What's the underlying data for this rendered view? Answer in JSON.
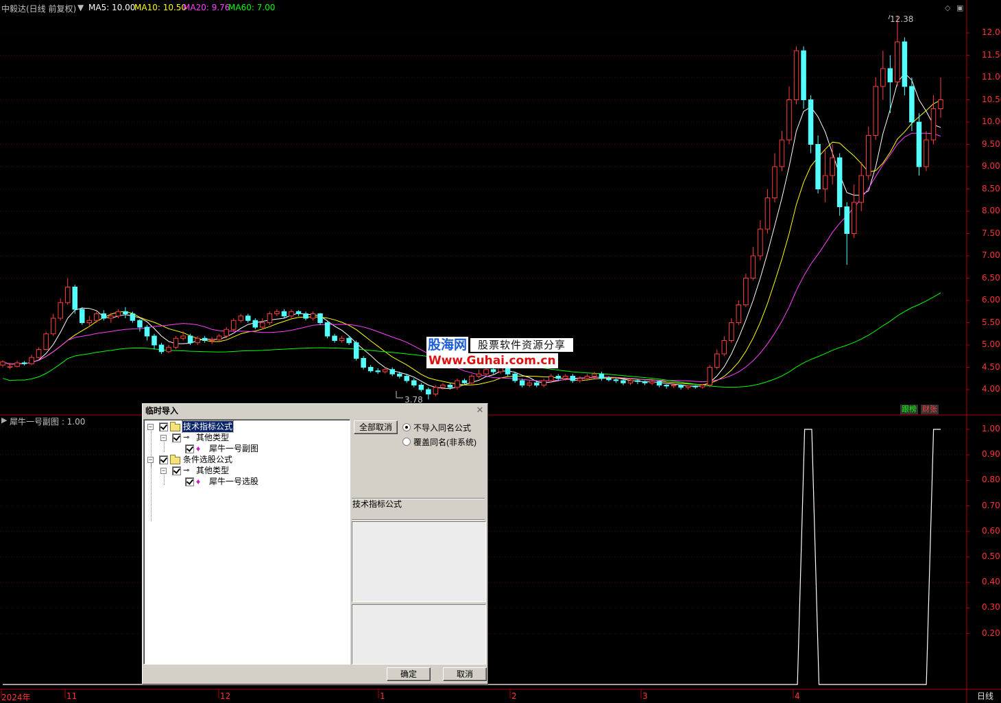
{
  "header": {
    "stock_title": "中毅达(日线 前复权)",
    "indicators": [
      {
        "label": "MA5: 10.00",
        "color": "#ffffff"
      },
      {
        "label": "MA10: 10.50",
        "color": "#ffff00"
      },
      {
        "label": "MA20: 9.76",
        "color": "#ff40ff"
      },
      {
        "label": "MA60: 7.00",
        "color": "#00ff00"
      }
    ]
  },
  "sub_header": {
    "label": "犀牛一号副图 : 1.00"
  },
  "price_axis": [
    "12.00",
    "11.50",
    "11.00",
    "10.50",
    "10.00",
    "9.50",
    "9.00",
    "8.50",
    "8.00",
    "7.50",
    "7.00",
    "6.50",
    "6.00",
    "5.50",
    "5.00",
    "4.50",
    "4.00"
  ],
  "sub_axis": [
    "1.00",
    "0.90",
    "0.80",
    "0.70",
    "0.60",
    "0.50",
    "0.40",
    "0.30",
    "0.20"
  ],
  "time_axis": [
    "2024年",
    "11",
    "12",
    "1",
    "2",
    "3",
    "4"
  ],
  "period": "日线",
  "tags": {
    "left": "跟榜",
    "right": "财张"
  },
  "annotations": {
    "high": "12.38",
    "low": "3.78"
  },
  "watermark": {
    "logo": "股海网",
    "slogan": "股票软件资源分享",
    "url": "Www.Guhai.com.cn"
  },
  "dialog": {
    "title": "临时导入",
    "tree": [
      {
        "label": "技术指标公式",
        "level": 0,
        "type": "folder",
        "selected": true
      },
      {
        "label": "其他类型",
        "level": 1,
        "type": "type"
      },
      {
        "label": "犀牛一号副图",
        "level": 2,
        "type": "formula"
      },
      {
        "label": "条件选股公式",
        "level": 0,
        "type": "folder"
      },
      {
        "label": "其他类型",
        "level": 1,
        "type": "type"
      },
      {
        "label": "犀牛一号选股",
        "level": 2,
        "type": "formula"
      }
    ],
    "cancel_all": "全部取消",
    "options": [
      {
        "label": "不导入同名公式",
        "checked": true
      },
      {
        "label": "覆盖同名(非系统)",
        "checked": false
      }
    ],
    "info_label": "技术指标公式",
    "ok": "确定",
    "cancel": "取消"
  },
  "chart_data": [
    {
      "type": "candlestick",
      "title": "中毅达(日线 前复权)",
      "ylim": [
        3.6,
        12.4
      ],
      "x_ticks": [
        "2024年",
        "11",
        "12",
        "1",
        "2",
        "3",
        "4"
      ],
      "annotations": [
        {
          "label": "12.38",
          "kind": "high"
        },
        {
          "label": "3.78",
          "kind": "low"
        }
      ],
      "candles": [
        [
          4.55,
          4.62,
          4.5,
          4.66
        ],
        [
          4.5,
          4.52,
          4.46,
          4.6
        ],
        [
          4.52,
          4.6,
          4.5,
          4.65
        ],
        [
          4.6,
          4.58,
          4.54,
          4.64
        ],
        [
          4.58,
          4.72,
          4.55,
          4.78
        ],
        [
          4.72,
          4.9,
          4.7,
          4.95
        ],
        [
          4.9,
          5.25,
          4.88,
          5.3
        ],
        [
          5.25,
          5.6,
          5.2,
          5.7
        ],
        [
          5.6,
          5.95,
          5.55,
          6.05
        ],
        [
          5.95,
          6.3,
          5.9,
          6.5
        ],
        [
          6.3,
          5.8,
          5.7,
          6.35
        ],
        [
          5.8,
          5.5,
          5.45,
          5.85
        ],
        [
          5.5,
          5.55,
          5.4,
          5.65
        ],
        [
          5.55,
          5.7,
          5.5,
          5.75
        ],
        [
          5.7,
          5.6,
          5.55,
          5.78
        ],
        [
          5.6,
          5.65,
          5.5,
          5.72
        ],
        [
          5.65,
          5.75,
          5.6,
          5.8
        ],
        [
          5.75,
          5.7,
          5.6,
          5.85
        ],
        [
          5.7,
          5.55,
          5.5,
          5.75
        ],
        [
          5.55,
          5.4,
          5.3,
          5.58
        ],
        [
          5.4,
          5.2,
          5.1,
          5.45
        ],
        [
          5.2,
          5.0,
          4.9,
          5.25
        ],
        [
          5.0,
          4.85,
          4.8,
          5.05
        ],
        [
          4.85,
          4.95,
          4.82,
          5.0
        ],
        [
          4.95,
          5.15,
          4.9,
          5.2
        ],
        [
          5.15,
          5.2,
          5.1,
          5.3
        ],
        [
          5.2,
          5.05,
          5.0,
          5.25
        ],
        [
          5.05,
          5.15,
          5.0,
          5.2
        ],
        [
          5.15,
          5.1,
          5.05,
          5.2
        ],
        [
          5.1,
          5.12,
          5.02,
          5.18
        ],
        [
          5.12,
          5.2,
          5.08,
          5.25
        ],
        [
          5.2,
          5.35,
          5.15,
          5.4
        ],
        [
          5.35,
          5.55,
          5.3,
          5.6
        ],
        [
          5.55,
          5.65,
          5.5,
          5.7
        ],
        [
          5.65,
          5.55,
          5.5,
          5.7
        ],
        [
          5.55,
          5.4,
          5.35,
          5.6
        ],
        [
          5.4,
          5.5,
          5.35,
          5.6
        ],
        [
          5.5,
          5.7,
          5.45,
          5.75
        ],
        [
          5.7,
          5.75,
          5.65,
          5.8
        ],
        [
          5.75,
          5.65,
          5.6,
          5.8
        ],
        [
          5.65,
          5.75,
          5.6,
          5.8
        ],
        [
          5.75,
          5.7,
          5.65,
          5.78
        ],
        [
          5.7,
          5.6,
          5.55,
          5.75
        ],
        [
          5.6,
          5.7,
          5.55,
          5.75
        ],
        [
          5.7,
          5.5,
          5.45,
          5.72
        ],
        [
          5.5,
          5.2,
          5.15,
          5.55
        ],
        [
          5.2,
          5.1,
          5.05,
          5.25
        ],
        [
          5.1,
          5.15,
          5.05,
          5.2
        ],
        [
          5.15,
          5.05,
          5.0,
          5.2
        ],
        [
          5.05,
          4.7,
          4.65,
          5.1
        ],
        [
          4.7,
          4.5,
          4.45,
          4.75
        ],
        [
          4.5,
          4.42,
          4.38,
          4.55
        ],
        [
          4.42,
          4.4,
          4.35,
          4.48
        ],
        [
          4.4,
          4.45,
          4.36,
          4.5
        ],
        [
          4.45,
          4.35,
          4.3,
          4.5
        ],
        [
          4.35,
          4.3,
          4.25,
          4.4
        ],
        [
          4.3,
          4.2,
          4.15,
          4.35
        ],
        [
          4.2,
          4.1,
          4.05,
          4.25
        ],
        [
          4.1,
          4.0,
          3.95,
          4.15
        ],
        [
          4.0,
          3.9,
          3.78,
          4.05
        ],
        [
          3.9,
          4.05,
          3.85,
          4.1
        ],
        [
          4.05,
          4.1,
          4.0,
          4.15
        ],
        [
          4.1,
          4.05,
          4.0,
          4.15
        ],
        [
          4.05,
          4.2,
          4.0,
          4.25
        ],
        [
          4.2,
          4.15,
          4.1,
          4.25
        ],
        [
          4.15,
          4.3,
          4.1,
          4.35
        ],
        [
          4.3,
          4.35,
          4.25,
          4.45
        ],
        [
          4.35,
          4.45,
          4.3,
          4.5
        ],
        [
          4.45,
          4.4,
          4.35,
          4.5
        ],
        [
          4.4,
          4.55,
          4.35,
          4.6
        ],
        [
          4.55,
          4.35,
          4.3,
          4.58
        ],
        [
          4.35,
          4.2,
          4.15,
          4.4
        ],
        [
          4.2,
          4.1,
          4.05,
          4.25
        ],
        [
          4.1,
          4.15,
          4.05,
          4.2
        ],
        [
          4.15,
          4.1,
          4.05,
          4.2
        ],
        [
          4.1,
          4.2,
          4.05,
          4.25
        ],
        [
          4.2,
          4.3,
          4.15,
          4.35
        ],
        [
          4.3,
          4.25,
          4.2,
          4.35
        ],
        [
          4.25,
          4.3,
          4.2,
          4.35
        ],
        [
          4.3,
          4.2,
          4.15,
          4.35
        ],
        [
          4.2,
          4.25,
          4.15,
          4.3
        ],
        [
          4.25,
          4.3,
          4.2,
          4.35
        ],
        [
          4.3,
          4.35,
          4.25,
          4.4
        ],
        [
          4.35,
          4.25,
          4.2,
          4.4
        ],
        [
          4.25,
          4.22,
          4.18,
          4.3
        ],
        [
          4.22,
          4.2,
          4.15,
          4.25
        ],
        [
          4.2,
          4.15,
          4.1,
          4.25
        ],
        [
          4.15,
          4.2,
          4.1,
          4.25
        ],
        [
          4.2,
          4.18,
          4.12,
          4.22
        ],
        [
          4.18,
          4.15,
          4.1,
          4.2
        ],
        [
          4.15,
          4.18,
          4.1,
          4.22
        ],
        [
          4.18,
          4.1,
          4.05,
          4.2
        ],
        [
          4.1,
          4.08,
          4.02,
          4.12
        ],
        [
          4.08,
          4.1,
          4.03,
          4.14
        ],
        [
          4.1,
          4.05,
          4.0,
          4.12
        ],
        [
          4.05,
          4.08,
          4.0,
          4.1
        ],
        [
          4.08,
          4.06,
          4.02,
          4.1
        ],
        [
          4.06,
          4.1,
          4.02,
          4.12
        ],
        [
          4.1,
          4.5,
          4.05,
          4.55
        ],
        [
          4.5,
          4.8,
          4.45,
          4.9
        ],
        [
          4.8,
          5.1,
          4.75,
          5.2
        ],
        [
          5.1,
          5.5,
          5.05,
          5.6
        ],
        [
          5.5,
          5.9,
          5.45,
          6.0
        ],
        [
          5.9,
          6.5,
          5.85,
          6.6
        ],
        [
          6.5,
          7.0,
          6.45,
          7.2
        ],
        [
          7.0,
          7.6,
          6.9,
          7.8
        ],
        [
          7.6,
          8.3,
          7.5,
          8.5
        ],
        [
          8.3,
          9.0,
          8.2,
          9.3
        ],
        [
          9.0,
          9.6,
          8.9,
          9.8
        ],
        [
          9.6,
          10.5,
          9.5,
          10.8
        ],
        [
          10.5,
          11.6,
          10.4,
          11.7
        ],
        [
          11.6,
          10.5,
          10.3,
          11.7
        ],
        [
          10.5,
          9.5,
          9.3,
          10.6
        ],
        [
          9.5,
          8.5,
          8.4,
          9.7
        ],
        [
          8.5,
          8.8,
          8.2,
          9.4
        ],
        [
          8.8,
          9.2,
          8.6,
          9.5
        ],
        [
          9.2,
          8.1,
          7.9,
          9.3
        ],
        [
          8.1,
          7.5,
          6.8,
          8.2
        ],
        [
          7.5,
          8.2,
          7.4,
          8.6
        ],
        [
          8.2,
          8.8,
          8.0,
          9.1
        ],
        [
          8.8,
          9.7,
          8.7,
          9.9
        ],
        [
          9.7,
          10.8,
          9.6,
          11.0
        ],
        [
          10.8,
          11.2,
          10.5,
          11.6
        ],
        [
          11.2,
          10.9,
          10.2,
          11.5
        ],
        [
          10.9,
          11.8,
          10.8,
          12.38
        ],
        [
          11.8,
          10.8,
          10.6,
          11.9
        ],
        [
          10.8,
          10.0,
          9.8,
          11.0
        ],
        [
          10.0,
          9.0,
          8.8,
          10.2
        ],
        [
          9.0,
          9.6,
          8.9,
          9.8
        ],
        [
          9.6,
          10.3,
          9.5,
          10.6
        ],
        [
          10.3,
          10.5,
          10.1,
          11.0
        ]
      ],
      "moving_averages": [
        {
          "name": "MA5",
          "value": 10.0,
          "color": "#ffffff"
        },
        {
          "name": "MA10",
          "value": 10.5,
          "color": "#ffff00"
        },
        {
          "name": "MA20",
          "value": 9.76,
          "color": "#ff40ff"
        },
        {
          "name": "MA60",
          "value": 7.0,
          "color": "#00ff00"
        }
      ]
    },
    {
      "type": "line",
      "title": "犀牛一号副图",
      "ylim": [
        0,
        1.0
      ],
      "series": [
        {
          "values": [
            0,
            0,
            0,
            0,
            0,
            0,
            0,
            0,
            0,
            0,
            0,
            0,
            0,
            0,
            0,
            0,
            0,
            0,
            0,
            0,
            0,
            0,
            0,
            0,
            0,
            0,
            0,
            0,
            0,
            0,
            0,
            0,
            0,
            0,
            0,
            0,
            0,
            0,
            0,
            0,
            0,
            0,
            0,
            0,
            0,
            0,
            0,
            0,
            0,
            0,
            0,
            0,
            0,
            0,
            0,
            0,
            0,
            0,
            0,
            0,
            0,
            0,
            0,
            0,
            0,
            0,
            0,
            0,
            0,
            0,
            0,
            0,
            0,
            0,
            0,
            0,
            0,
            0,
            0,
            0,
            0,
            0,
            0,
            0,
            0,
            0,
            0,
            0,
            0,
            0,
            0,
            0,
            0,
            0,
            0,
            0,
            0,
            0,
            0,
            0,
            0,
            0,
            0,
            0,
            0,
            0,
            0,
            0,
            0,
            0,
            0,
            0,
            1,
            1,
            0,
            0,
            0,
            0,
            0,
            0,
            0,
            0,
            0,
            0,
            0,
            0,
            0,
            0,
            0,
            0,
            1,
            1
          ]
        }
      ]
    }
  ]
}
